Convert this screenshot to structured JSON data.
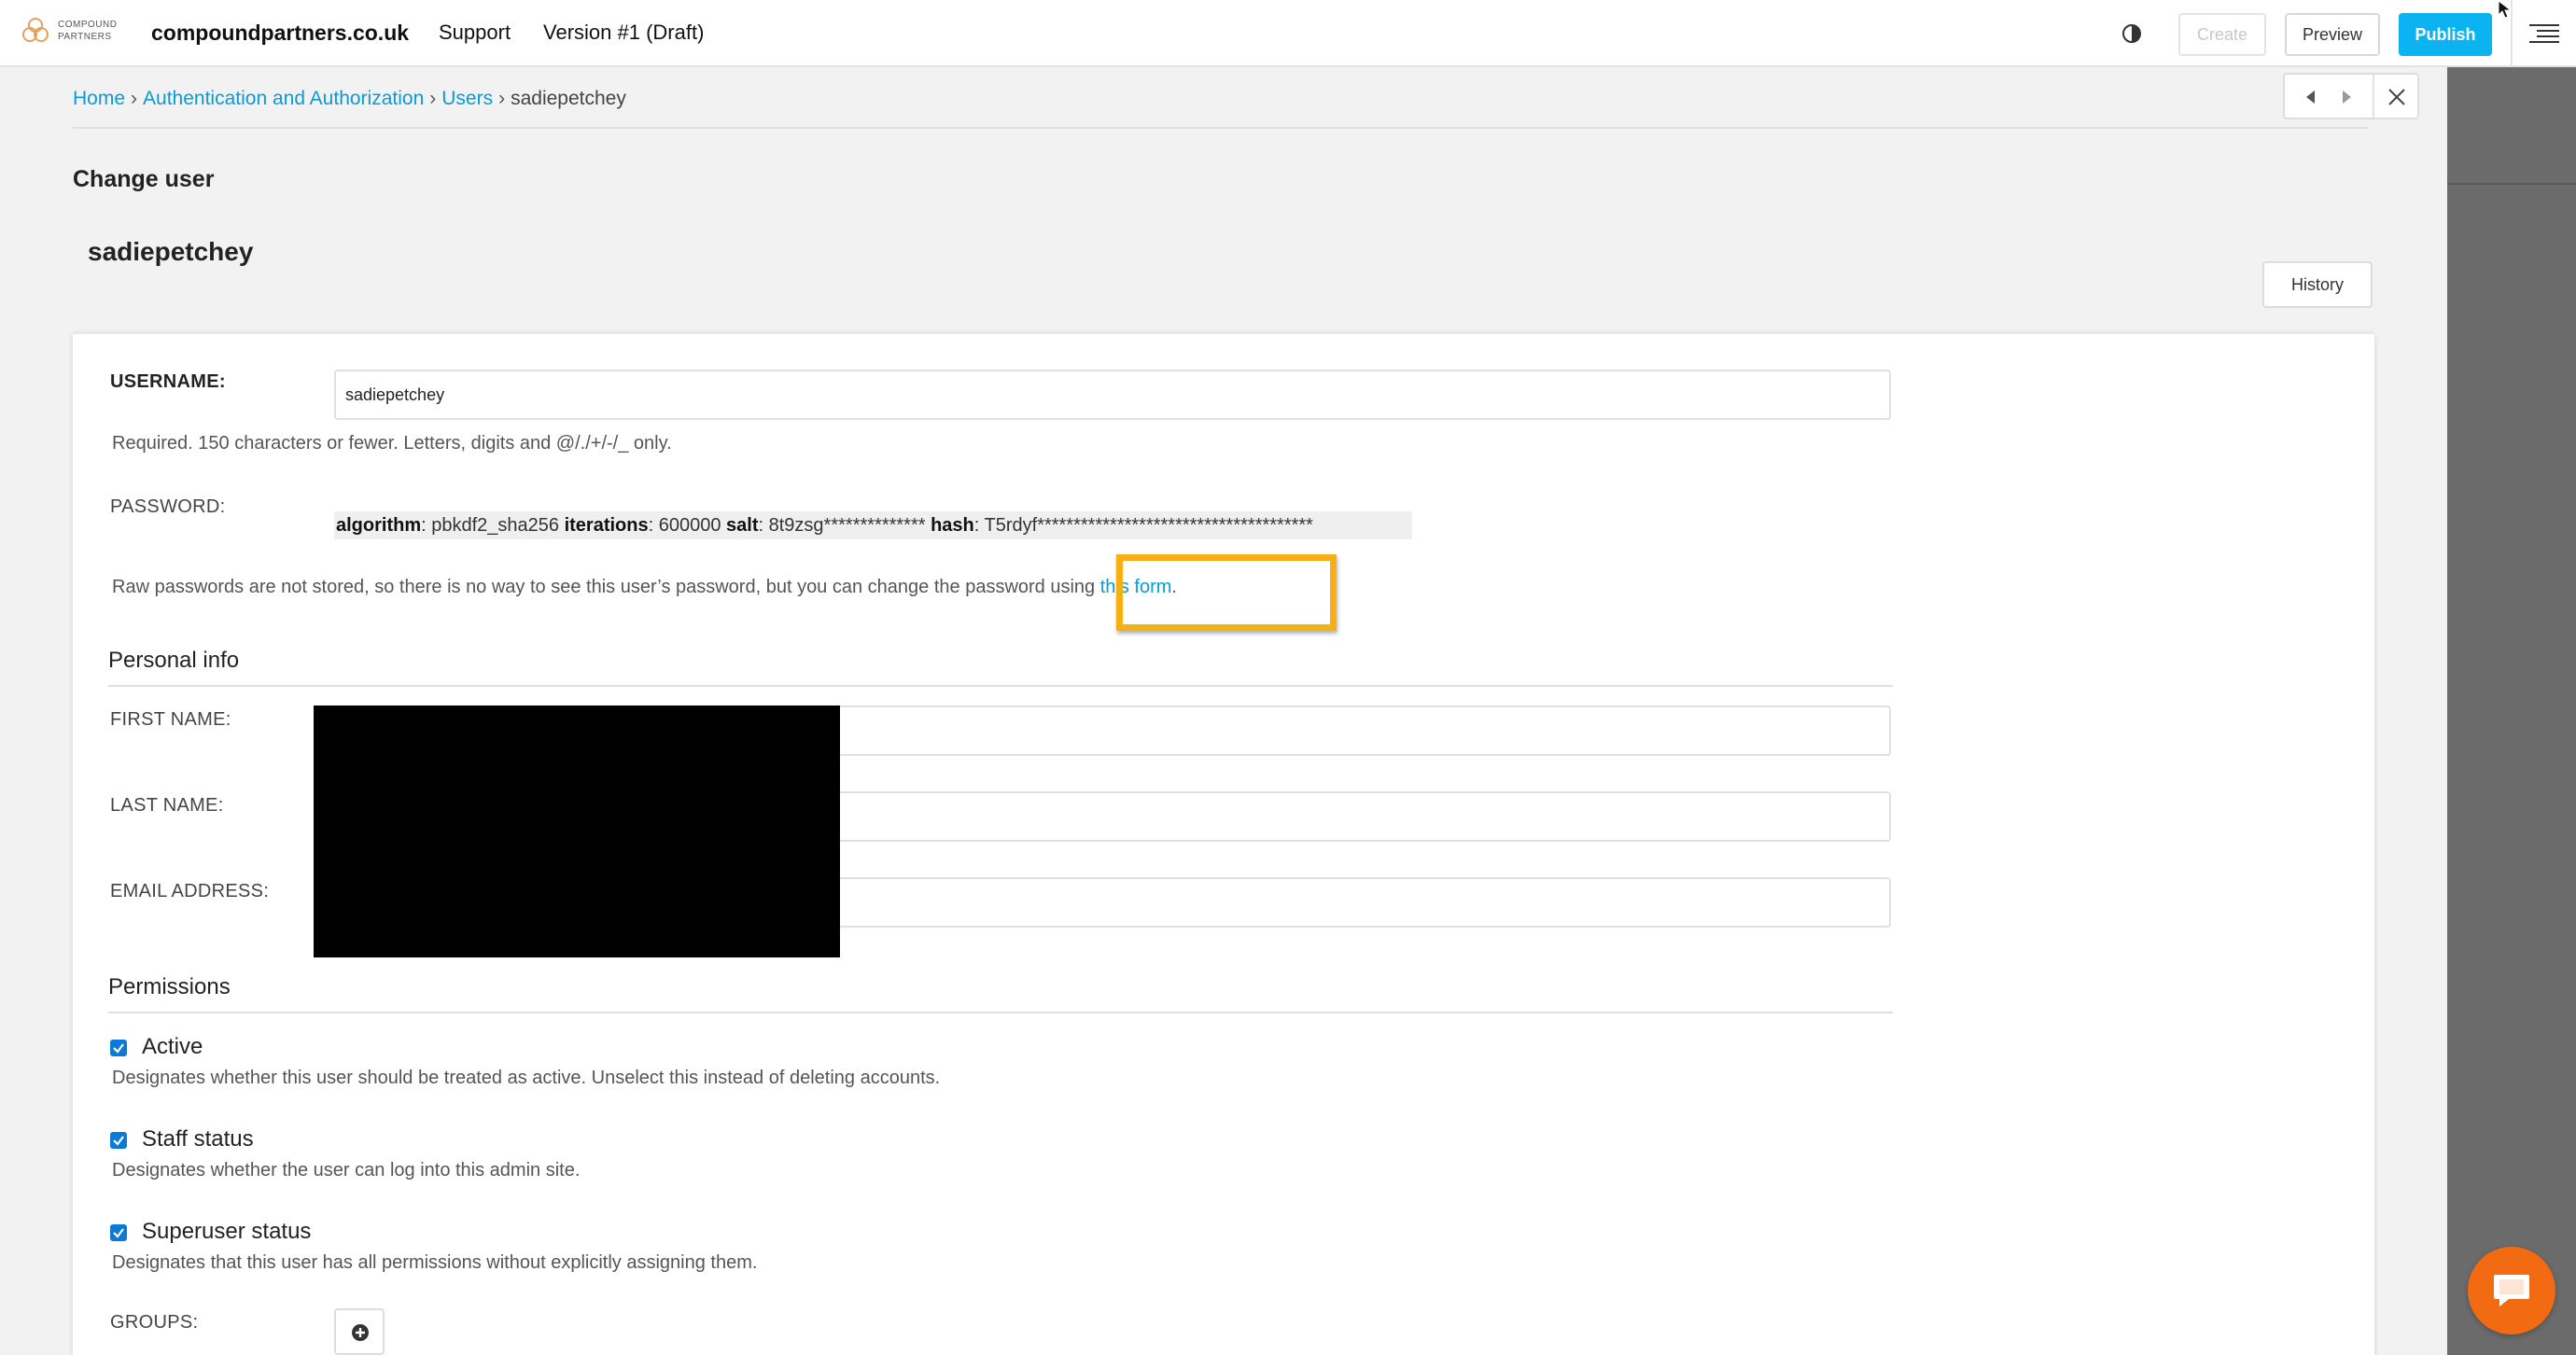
{
  "toolbar": {
    "logo_line1": "COMPOUND",
    "logo_line2": "PARTNERS",
    "site_name": "compoundpartners.co.uk",
    "support": "Support",
    "version": "Version #1 (Draft)",
    "create": "Create",
    "preview": "Preview",
    "publish": "Publish"
  },
  "breadcrumb": {
    "home": "Home",
    "section": "Authentication and Authorization",
    "users": "Users",
    "current": "sadiepetchey",
    "separator": "›"
  },
  "page": {
    "heading": "Change user",
    "object_title": "sadiepetchey",
    "history": "History"
  },
  "form": {
    "username_label": "USERNAME:",
    "username_value": "sadiepetchey",
    "username_help": "Required. 150 characters or fewer. Letters, digits and @/./+/-/_ only.",
    "password_label": "PASSWORD:",
    "pw_algorithm_key": "algorithm",
    "pw_algorithm_val": ": pbkdf2_sha256 ",
    "pw_iterations_key": "iterations",
    "pw_iterations_val": ": 600000 ",
    "pw_salt_key": "salt",
    "pw_salt_val": ": 8t9zsg************** ",
    "pw_hash_key": "hash",
    "pw_hash_val": ": T5rdyf**************************************",
    "password_help": "Raw passwords are not stored, so there is no way to see this user’s password, but you can change the password using ",
    "password_link": "this form",
    "password_help_end": ".",
    "personal_info": "Personal info",
    "first_name_label": "FIRST NAME:",
    "last_name_label": "LAST NAME:",
    "email_label": "EMAIL ADDRESS:",
    "permissions": "Permissions",
    "active_label": "Active",
    "active_help": "Designates whether this user should be treated as active. Unselect this instead of deleting accounts.",
    "staff_label": "Staff status",
    "staff_help": "Designates whether the user can log into this admin site.",
    "superuser_label": "Superuser status",
    "superuser_help": "Designates that this user has all permissions without explicitly assigning them.",
    "groups_label": "GROUPS:"
  },
  "checkboxes": {
    "active": true,
    "staff": true,
    "superuser": true
  },
  "colors": {
    "accent": "#0bb4f0",
    "link": "#0b9ad6",
    "highlight": "#f5b014",
    "chat": "#f26a12"
  },
  "icons": [
    "logo-icon",
    "contrast-icon",
    "menu-icon",
    "arrow-left-icon",
    "arrow-right-icon",
    "close-icon",
    "check-icon",
    "plus-circle-icon",
    "chat-icon",
    "cursor-icon"
  ]
}
